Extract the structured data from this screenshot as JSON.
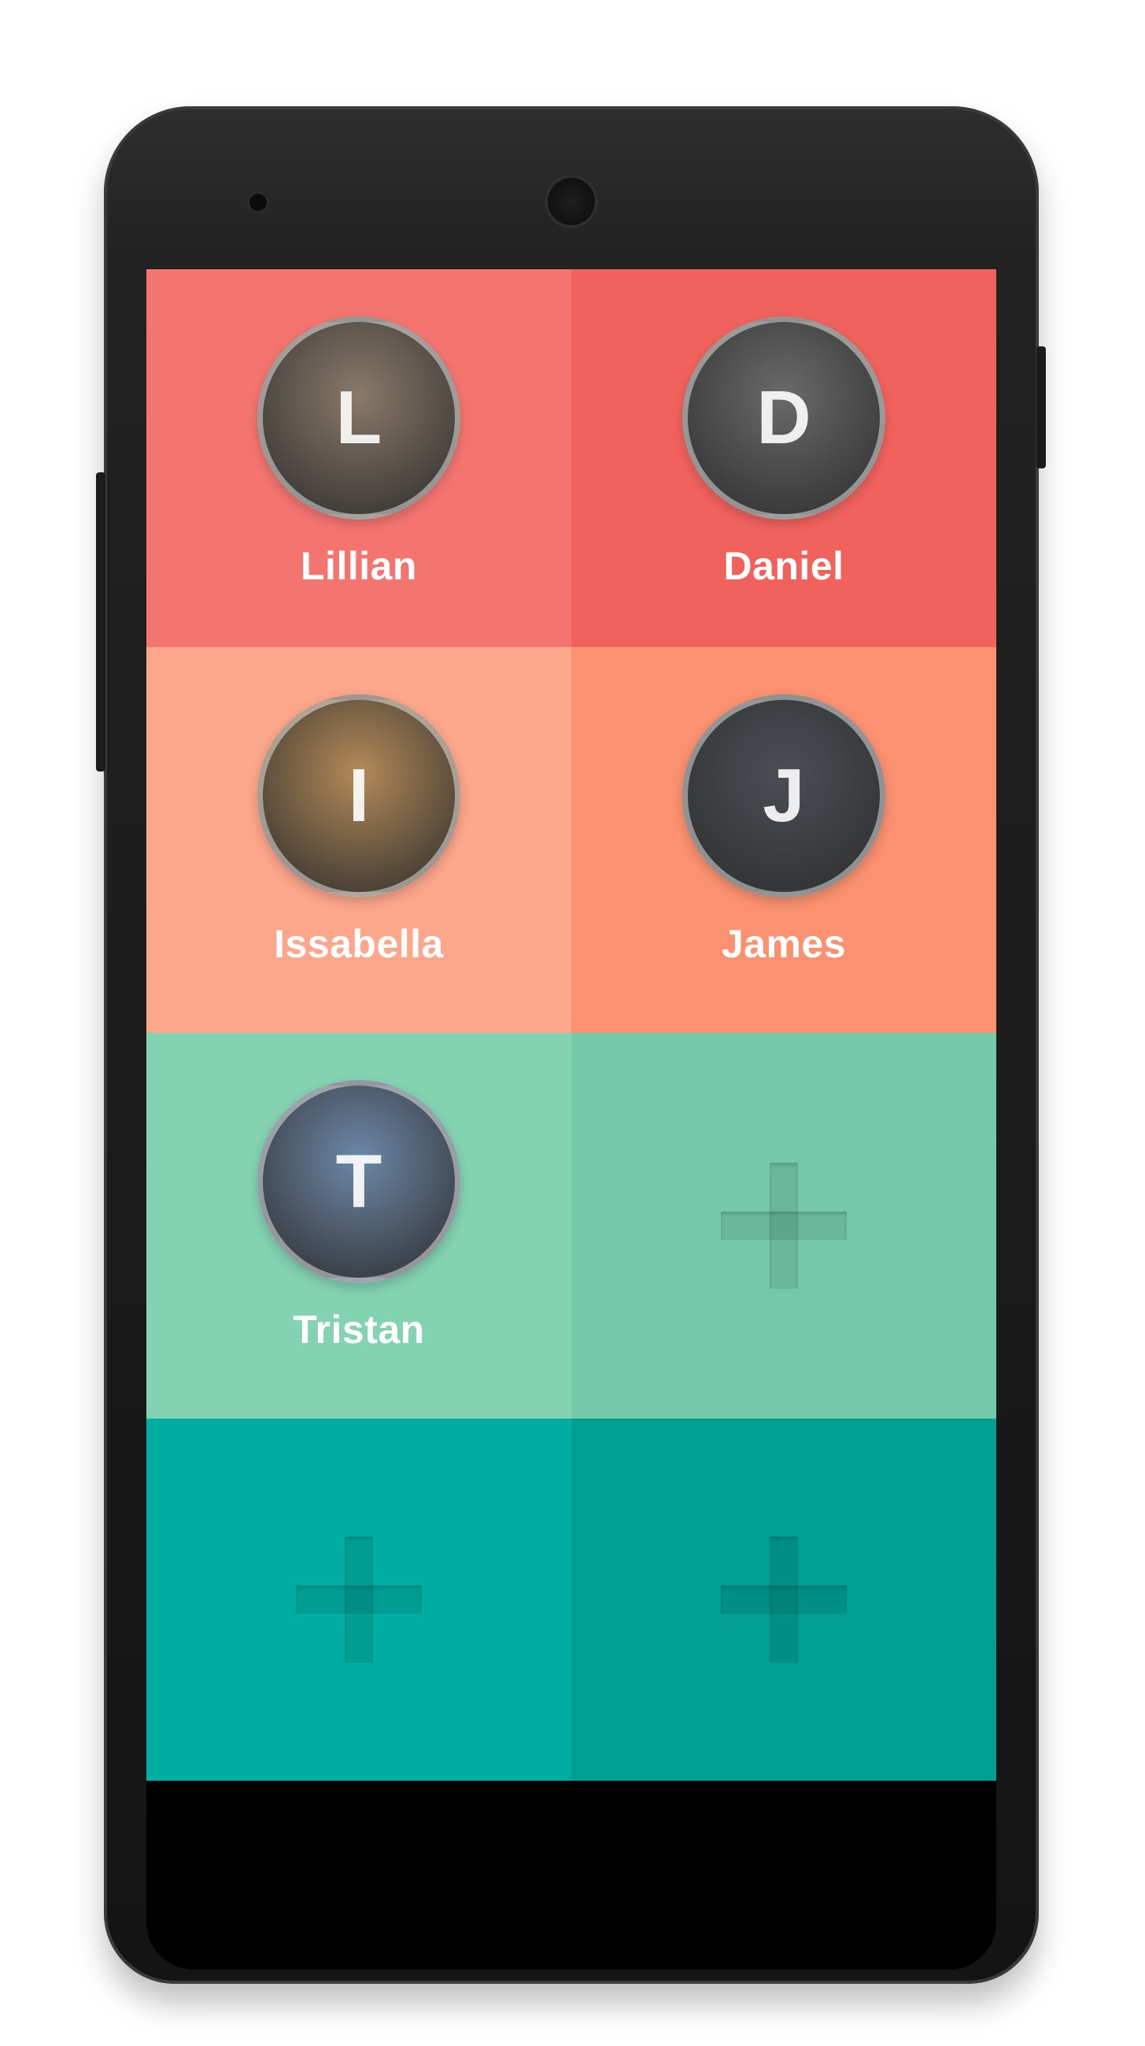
{
  "colors": {
    "row1_left": "#F47570",
    "row1_right": "#F2625D",
    "row2_left": "#FCA68B",
    "row2_right": "#FB9170",
    "row3_left": "#83D2B2",
    "row3_right": "#74C9A9",
    "row4_left": "#00ADA2",
    "row4_right": "#009E93"
  },
  "tiles": [
    {
      "name": "Lillian",
      "avatar": "L",
      "avatar_bg": "#8a7a6a"
    },
    {
      "name": "Daniel",
      "avatar": "D",
      "avatar_bg": "#6a6a6a"
    },
    {
      "name": "Issabella",
      "avatar": "I",
      "avatar_bg": "#b38a58"
    },
    {
      "name": "James",
      "avatar": "J",
      "avatar_bg": "#4a4f55"
    },
    {
      "name": "Tristan",
      "avatar": "T",
      "avatar_bg": "#6d88a8"
    }
  ],
  "icons": {
    "add": "plus-icon",
    "camera": "front-camera-icon",
    "speaker": "speaker-icon"
  }
}
